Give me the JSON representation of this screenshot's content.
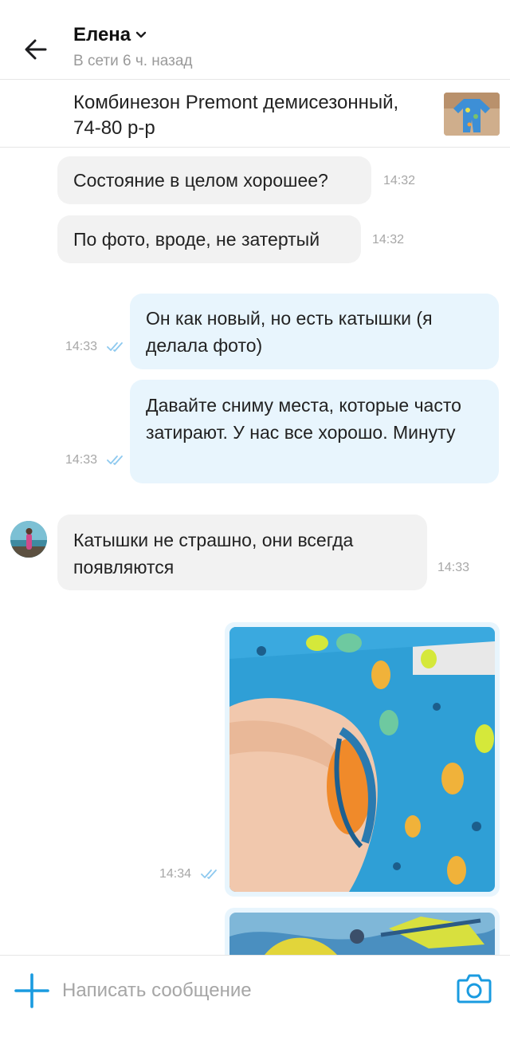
{
  "header": {
    "contact_name": "Елена",
    "status": "В сети 6 ч. назад",
    "icons": {
      "back": "arrow-left-icon",
      "dropdown": "chevron-down-icon"
    }
  },
  "product": {
    "title": "Комбинезон Premont демисезонный, 74-80 р-р"
  },
  "messages": [
    {
      "direction": "in",
      "text": "Состояние в целом хорошее?",
      "time": "14:32"
    },
    {
      "direction": "in",
      "text": "По фото, вроде, не затертый",
      "time": "14:32"
    },
    {
      "direction": "out",
      "text": "Он как новый, но есть катышки (я делала фото)",
      "time": "14:33",
      "read": true
    },
    {
      "direction": "out",
      "text": "Давайте сниму места, которые часто затирают. У нас все хорошо. Минуту",
      "time": "14:33",
      "read": true
    },
    {
      "direction": "in",
      "text": "Катышки не страшно, они всегда появляются",
      "time": "14:33"
    },
    {
      "direction": "out",
      "type": "image",
      "time": "14:34",
      "read": true
    },
    {
      "direction": "out",
      "type": "image"
    }
  ],
  "composer": {
    "placeholder": "Написать сообщение",
    "icons": {
      "attach": "plus-icon",
      "camera": "camera-icon"
    }
  },
  "colors": {
    "accent": "#1a9be0",
    "incoming_bubble": "#f2f2f2",
    "outgoing_bubble": "#e8f5fd",
    "read_ticks": "#8ec9ef"
  }
}
